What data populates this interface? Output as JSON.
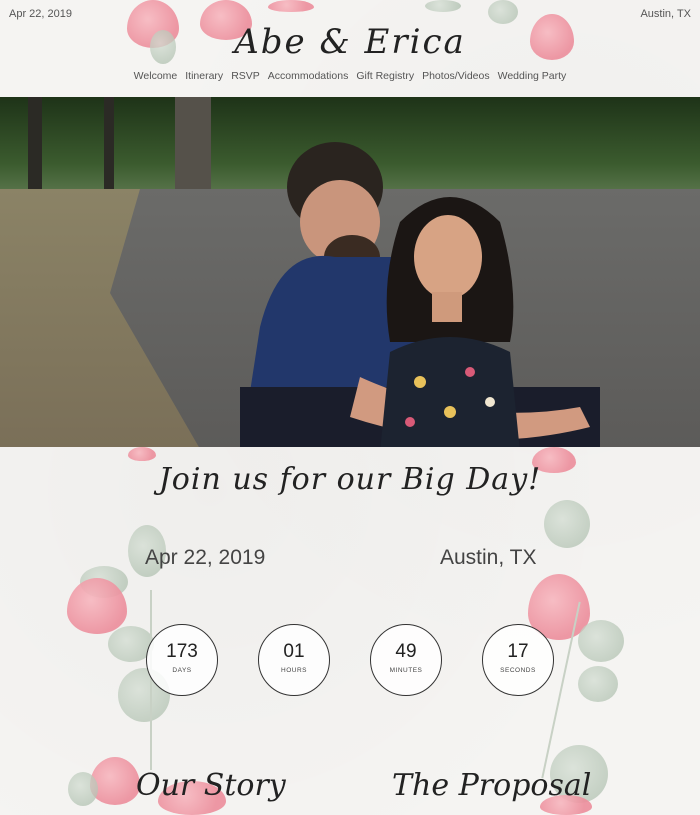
{
  "header": {
    "date": "Apr 22, 2019",
    "location": "Austin, TX",
    "title": "Abe & Erica",
    "nav": [
      "Welcome",
      "Itinerary",
      "RSVP",
      "Accommodations",
      "Gift Registry",
      "Photos/Videos",
      "Wedding Party"
    ]
  },
  "event": {
    "heading": "Join us for our Big Day!",
    "date": "Apr 22, 2019",
    "location": "Austin, TX"
  },
  "countdown": [
    {
      "value": "173",
      "label": "DAYS"
    },
    {
      "value": "01",
      "label": "HOURS"
    },
    {
      "value": "49",
      "label": "MINUTES"
    },
    {
      "value": "17",
      "label": "SECONDS"
    }
  ],
  "sections": {
    "story": "Our Story",
    "proposal": "The Proposal"
  },
  "colors": {
    "petal": "#ec8d9b",
    "leaf": "#a9bba9",
    "text": "#222222"
  }
}
